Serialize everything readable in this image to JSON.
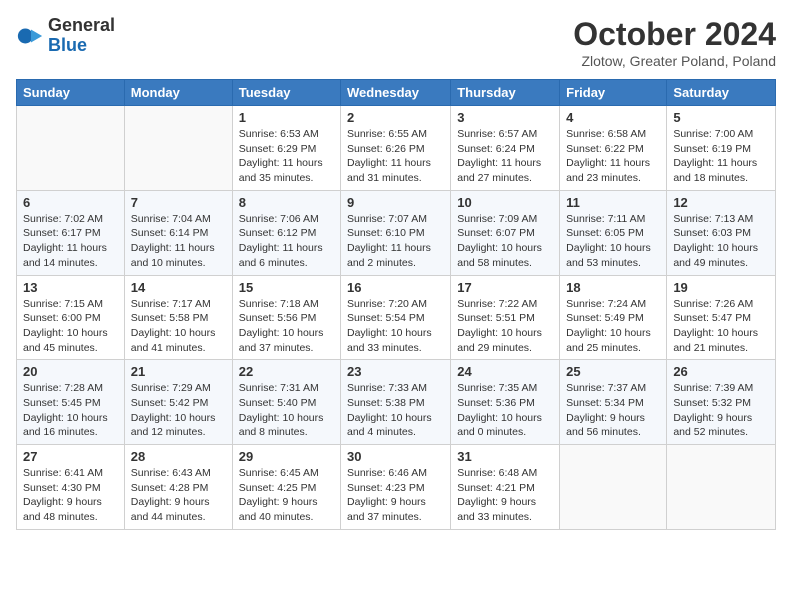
{
  "logo": {
    "general": "General",
    "blue": "Blue"
  },
  "title": "October 2024",
  "location": "Zlotow, Greater Poland, Poland",
  "days_of_week": [
    "Sunday",
    "Monday",
    "Tuesday",
    "Wednesday",
    "Thursday",
    "Friday",
    "Saturday"
  ],
  "weeks": [
    [
      {
        "day": "",
        "info": ""
      },
      {
        "day": "",
        "info": ""
      },
      {
        "day": "1",
        "info": "Sunrise: 6:53 AM\nSunset: 6:29 PM\nDaylight: 11 hours and 35 minutes."
      },
      {
        "day": "2",
        "info": "Sunrise: 6:55 AM\nSunset: 6:26 PM\nDaylight: 11 hours and 31 minutes."
      },
      {
        "day": "3",
        "info": "Sunrise: 6:57 AM\nSunset: 6:24 PM\nDaylight: 11 hours and 27 minutes."
      },
      {
        "day": "4",
        "info": "Sunrise: 6:58 AM\nSunset: 6:22 PM\nDaylight: 11 hours and 23 minutes."
      },
      {
        "day": "5",
        "info": "Sunrise: 7:00 AM\nSunset: 6:19 PM\nDaylight: 11 hours and 18 minutes."
      }
    ],
    [
      {
        "day": "6",
        "info": "Sunrise: 7:02 AM\nSunset: 6:17 PM\nDaylight: 11 hours and 14 minutes."
      },
      {
        "day": "7",
        "info": "Sunrise: 7:04 AM\nSunset: 6:14 PM\nDaylight: 11 hours and 10 minutes."
      },
      {
        "day": "8",
        "info": "Sunrise: 7:06 AM\nSunset: 6:12 PM\nDaylight: 11 hours and 6 minutes."
      },
      {
        "day": "9",
        "info": "Sunrise: 7:07 AM\nSunset: 6:10 PM\nDaylight: 11 hours and 2 minutes."
      },
      {
        "day": "10",
        "info": "Sunrise: 7:09 AM\nSunset: 6:07 PM\nDaylight: 10 hours and 58 minutes."
      },
      {
        "day": "11",
        "info": "Sunrise: 7:11 AM\nSunset: 6:05 PM\nDaylight: 10 hours and 53 minutes."
      },
      {
        "day": "12",
        "info": "Sunrise: 7:13 AM\nSunset: 6:03 PM\nDaylight: 10 hours and 49 minutes."
      }
    ],
    [
      {
        "day": "13",
        "info": "Sunrise: 7:15 AM\nSunset: 6:00 PM\nDaylight: 10 hours and 45 minutes."
      },
      {
        "day": "14",
        "info": "Sunrise: 7:17 AM\nSunset: 5:58 PM\nDaylight: 10 hours and 41 minutes."
      },
      {
        "day": "15",
        "info": "Sunrise: 7:18 AM\nSunset: 5:56 PM\nDaylight: 10 hours and 37 minutes."
      },
      {
        "day": "16",
        "info": "Sunrise: 7:20 AM\nSunset: 5:54 PM\nDaylight: 10 hours and 33 minutes."
      },
      {
        "day": "17",
        "info": "Sunrise: 7:22 AM\nSunset: 5:51 PM\nDaylight: 10 hours and 29 minutes."
      },
      {
        "day": "18",
        "info": "Sunrise: 7:24 AM\nSunset: 5:49 PM\nDaylight: 10 hours and 25 minutes."
      },
      {
        "day": "19",
        "info": "Sunrise: 7:26 AM\nSunset: 5:47 PM\nDaylight: 10 hours and 21 minutes."
      }
    ],
    [
      {
        "day": "20",
        "info": "Sunrise: 7:28 AM\nSunset: 5:45 PM\nDaylight: 10 hours and 16 minutes."
      },
      {
        "day": "21",
        "info": "Sunrise: 7:29 AM\nSunset: 5:42 PM\nDaylight: 10 hours and 12 minutes."
      },
      {
        "day": "22",
        "info": "Sunrise: 7:31 AM\nSunset: 5:40 PM\nDaylight: 10 hours and 8 minutes."
      },
      {
        "day": "23",
        "info": "Sunrise: 7:33 AM\nSunset: 5:38 PM\nDaylight: 10 hours and 4 minutes."
      },
      {
        "day": "24",
        "info": "Sunrise: 7:35 AM\nSunset: 5:36 PM\nDaylight: 10 hours and 0 minutes."
      },
      {
        "day": "25",
        "info": "Sunrise: 7:37 AM\nSunset: 5:34 PM\nDaylight: 9 hours and 56 minutes."
      },
      {
        "day": "26",
        "info": "Sunrise: 7:39 AM\nSunset: 5:32 PM\nDaylight: 9 hours and 52 minutes."
      }
    ],
    [
      {
        "day": "27",
        "info": "Sunrise: 6:41 AM\nSunset: 4:30 PM\nDaylight: 9 hours and 48 minutes."
      },
      {
        "day": "28",
        "info": "Sunrise: 6:43 AM\nSunset: 4:28 PM\nDaylight: 9 hours and 44 minutes."
      },
      {
        "day": "29",
        "info": "Sunrise: 6:45 AM\nSunset: 4:25 PM\nDaylight: 9 hours and 40 minutes."
      },
      {
        "day": "30",
        "info": "Sunrise: 6:46 AM\nSunset: 4:23 PM\nDaylight: 9 hours and 37 minutes."
      },
      {
        "day": "31",
        "info": "Sunrise: 6:48 AM\nSunset: 4:21 PM\nDaylight: 9 hours and 33 minutes."
      },
      {
        "day": "",
        "info": ""
      },
      {
        "day": "",
        "info": ""
      }
    ]
  ]
}
